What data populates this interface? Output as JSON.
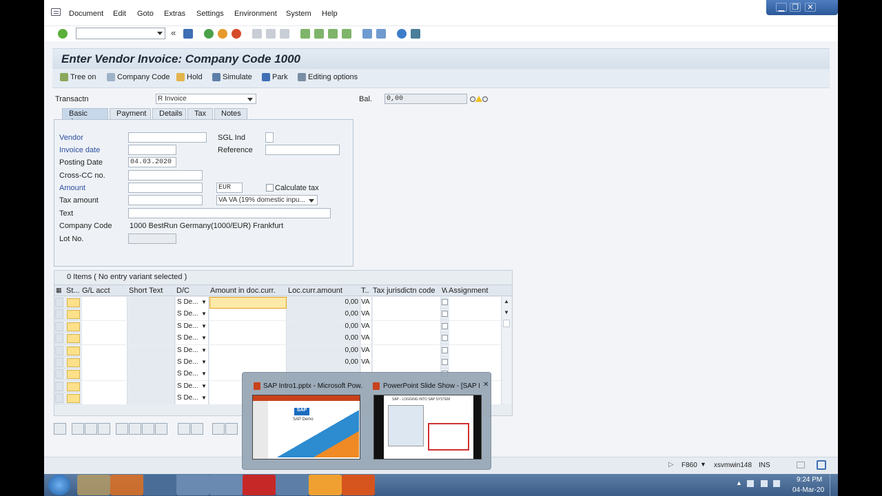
{
  "menubar": {
    "items": [
      "Document",
      "Edit",
      "Goto",
      "Extras",
      "Settings",
      "Environment",
      "System",
      "Help"
    ]
  },
  "window_controls": [
    "▁",
    "❐",
    "✕"
  ],
  "page_title": "Enter Vendor Invoice: Company Code 1000",
  "app_toolbar": [
    "Tree on",
    "Company Code",
    "Hold",
    "Simulate",
    "Park",
    "Editing options"
  ],
  "header": {
    "transactn_label": "Transactn",
    "transactn_value": "R Invoice",
    "bal_label": "Bal.",
    "bal_value": "0,00"
  },
  "tabs": [
    "Basic data",
    "Payment",
    "Details",
    "Tax",
    "Notes"
  ],
  "basic_data": {
    "vendor_label": "Vendor",
    "invoice_date_label": "Invoice date",
    "posting_date_label": "Posting Date",
    "posting_date_value": "04.03.2020",
    "cross_cc_label": "Cross-CC no.",
    "amount_label": "Amount",
    "currency_value": "EUR",
    "calculate_tax_label": "Calculate tax",
    "tax_amount_label": "Tax amount",
    "tax_code_value": "VA VA (19% domestic inpu...",
    "text_label": "Text",
    "company_code_label": "Company Code",
    "company_code_value": "1000 BestRun Germany(1000/EUR) Frankfurt",
    "lot_no_label": "Lot No.",
    "sgl_ind_label": "SGL Ind",
    "reference_label": "Reference"
  },
  "items": {
    "caption": "0 Items ( No entry variant selected )",
    "columns": [
      "St...",
      "G/L acct",
      "Short Text",
      "D/C",
      "Amount in doc.curr.",
      "Loc.curr.amount",
      "T..",
      "Tax jurisdictn code",
      "W",
      "Assignment"
    ],
    "rows": [
      {
        "dc": "S  De...",
        "loc": "0,00",
        "tax": "VA"
      },
      {
        "dc": "S  De...",
        "loc": "0,00",
        "tax": "VA"
      },
      {
        "dc": "S  De...",
        "loc": "0,00",
        "tax": "VA"
      },
      {
        "dc": "S  De...",
        "loc": "0,00",
        "tax": "VA"
      },
      {
        "dc": "S  De...",
        "loc": "0,00",
        "tax": "VA"
      },
      {
        "dc": "S  De...",
        "loc": "0,00",
        "tax": "VA"
      },
      {
        "dc": "S  De...",
        "loc": "",
        "tax": ""
      },
      {
        "dc": "S  De...",
        "loc": "",
        "tax": ""
      },
      {
        "dc": "S  De...",
        "loc": "",
        "tax": ""
      }
    ]
  },
  "thumbnails": [
    {
      "title": "SAP Intro1.pptx - Microsoft Pow...",
      "slide_text": "SAP Demo"
    },
    {
      "title": "PowerPoint Slide Show - [SAP I...",
      "slide_text": "SAP - LOGGING INTO SAP SYSTEM"
    }
  ],
  "statusbar": {
    "tcode": "F860",
    "server": "xsvmwin148",
    "mode": "INS"
  },
  "taskbar": {
    "time": "9:24 PM",
    "date": "04-Mar-20"
  },
  "colors": {
    "title_bar": "#d6e0ea",
    "required_label": "#2b4f9e",
    "status_box": "#fde08a",
    "taskbar": "#3b5c86"
  }
}
